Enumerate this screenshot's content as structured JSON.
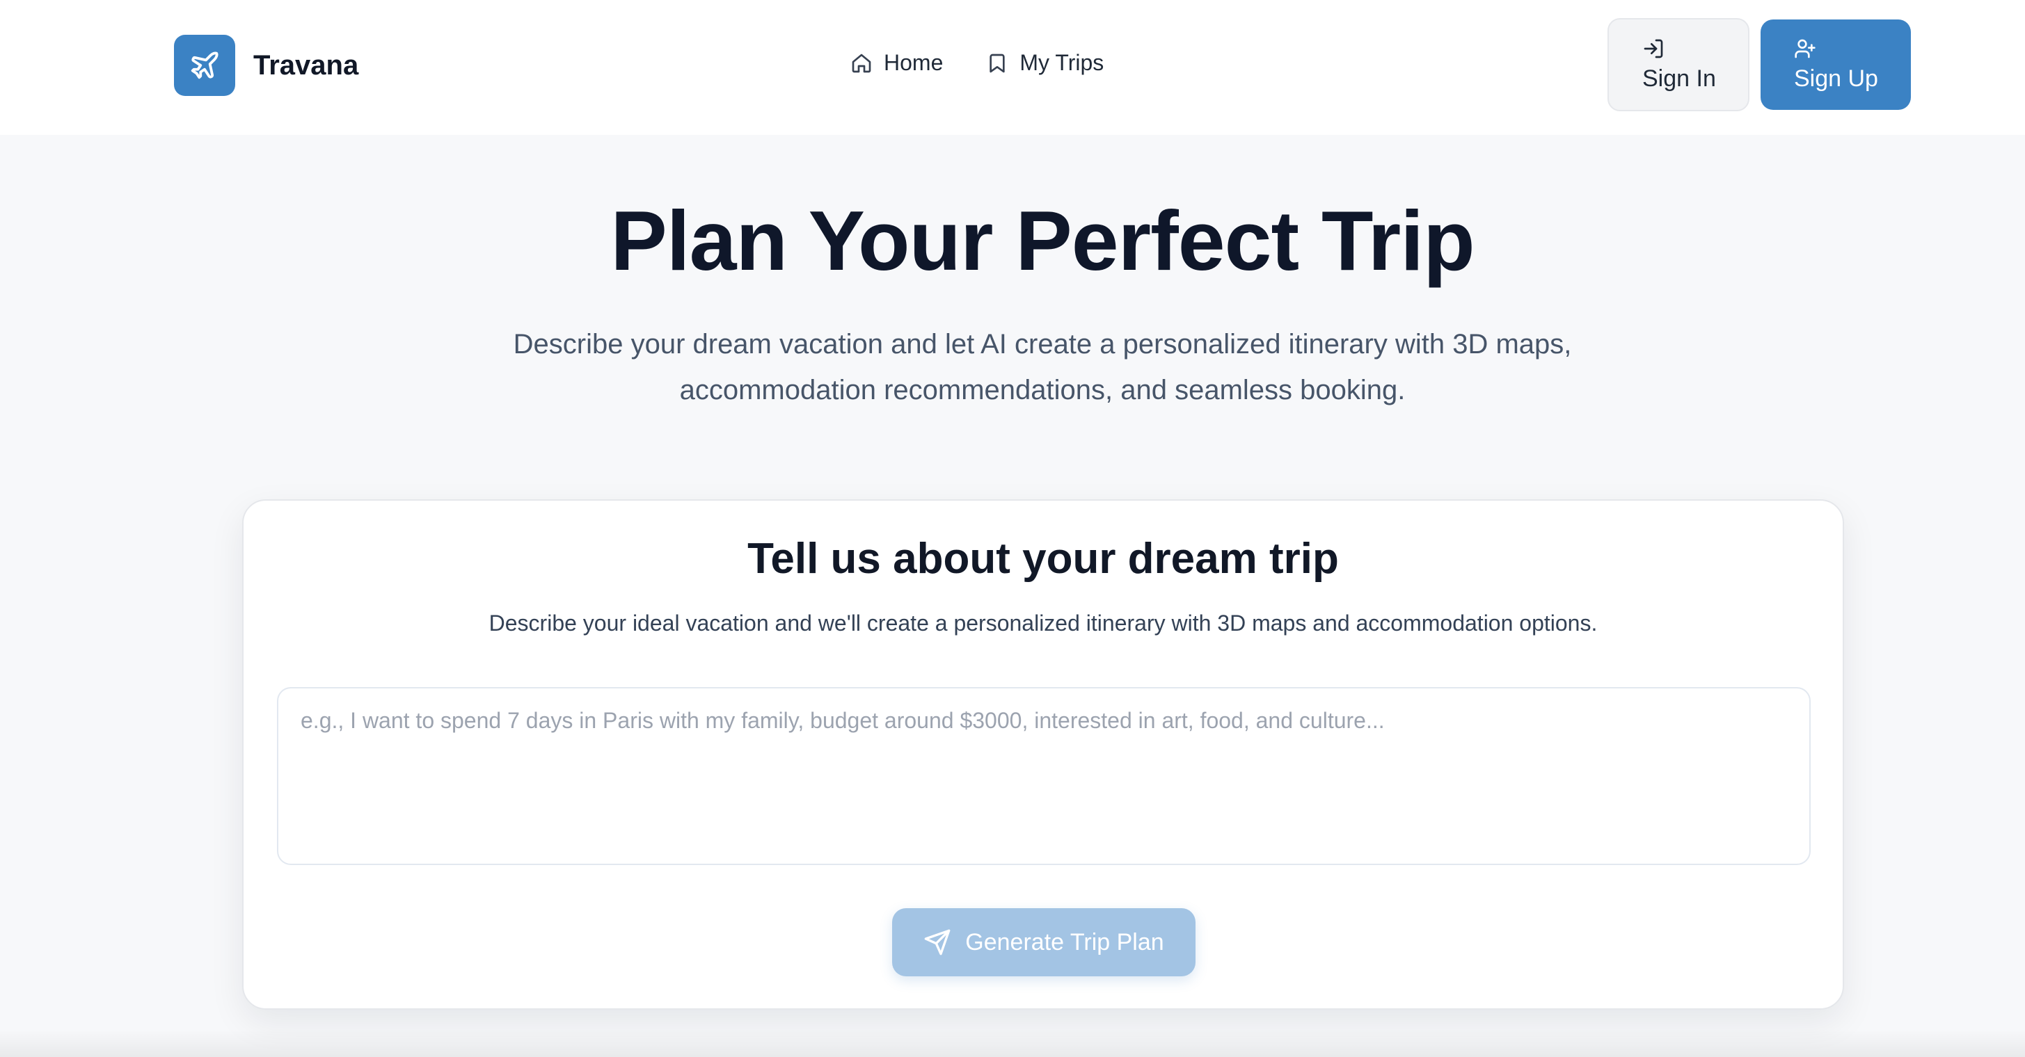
{
  "brand": {
    "name": "Travana",
    "icon": "plane-icon",
    "color": "#3b82c4"
  },
  "nav": {
    "items": [
      {
        "label": "Home",
        "icon": "home-icon"
      },
      {
        "label": "My Trips",
        "icon": "bookmark-icon"
      }
    ]
  },
  "auth": {
    "sign_in_label": "Sign In",
    "sign_in_icon": "log-in-icon",
    "sign_up_label": "Sign Up",
    "sign_up_icon": "user-plus-icon"
  },
  "hero": {
    "title": "Plan Your Perfect Trip",
    "subtitle": "Describe your dream vacation and let AI create a personalized itinerary with 3D maps, accommodation recommendations, and seamless booking."
  },
  "trip_form": {
    "title": "Tell us about your dream trip",
    "description": "Describe your ideal vacation and we'll create a personalized itinerary with 3D maps and accommodation options.",
    "input_value": "",
    "input_placeholder": "e.g., I want to spend 7 days in Paris with my family, budget around $3000, interested in art, food, and culture...",
    "submit_label": "Generate Trip Plan",
    "submit_icon": "send-icon",
    "submit_color": "#a3c4e4"
  }
}
